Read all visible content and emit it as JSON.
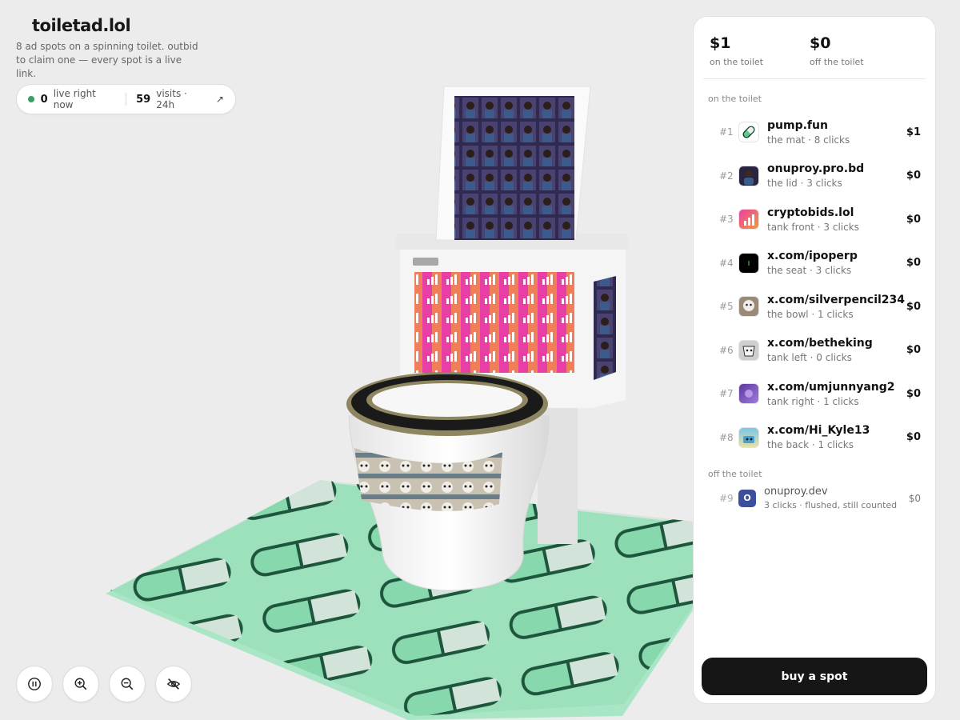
{
  "brand": {
    "title": "toiletad.lol",
    "tagline": "8 ad spots on a spinning toilet. outbid to claim one — every spot is a live link."
  },
  "stats": {
    "live_count": "0",
    "live_label": "live right now",
    "visits_count": "59",
    "visits_label": "visits · 24h",
    "arrow_icon": "↗"
  },
  "controls": {
    "pause_icon": "pause-icon",
    "zoom_in_icon": "zoom-in-icon",
    "zoom_out_icon": "zoom-out-icon",
    "hide_icon": "eye-off-icon"
  },
  "panel": {
    "on_total": "$1",
    "on_label": "on the toilet",
    "off_total": "$0",
    "off_label": "off the toilet",
    "on_section": "on the toilet",
    "off_section": "off the toilet",
    "spots": [
      {
        "rank": "#1",
        "name": "pump.fun",
        "sub": "the mat · 8 clicks",
        "price": "$1",
        "thumb_color": "#ffffff"
      },
      {
        "rank": "#2",
        "name": "onuproy.pro.bd",
        "sub": "the lid · 3 clicks",
        "price": "$0",
        "thumb_color": "#2a2440"
      },
      {
        "rank": "#3",
        "name": "cryptobids.lol",
        "sub": "tank front · 3 clicks",
        "price": "$0",
        "thumb_color": "#e83fa6"
      },
      {
        "rank": "#4",
        "name": "x.com/ipoperp",
        "sub": "the seat · 3 clicks",
        "price": "$0",
        "thumb_color": "#000000"
      },
      {
        "rank": "#5",
        "name": "x.com/silverpencil234",
        "sub": "the bowl · 1 clicks",
        "price": "$0",
        "thumb_color": "#9a8a78"
      },
      {
        "rank": "#6",
        "name": "x.com/betheking",
        "sub": "tank left · 0 clicks",
        "price": "$0",
        "thumb_color": "#cfcfcf"
      },
      {
        "rank": "#7",
        "name": "x.com/umjunnyang2",
        "sub": "tank right · 1 clicks",
        "price": "$0",
        "thumb_color": "#7a4bc4"
      },
      {
        "rank": "#8",
        "name": "x.com/Hi_Kyle13",
        "sub": "the back · 1 clicks",
        "price": "$0",
        "thumb_color": "#7ac6e8"
      }
    ],
    "off_spots": [
      {
        "rank": "#9",
        "initial": "O",
        "name": "onuproy.dev",
        "sub": "3 clicks · flushed, still counted",
        "price": "$0"
      }
    ],
    "buy_label": "buy a spot"
  },
  "colors": {
    "accent": "#161616",
    "live": "#3aa062",
    "mat": "#6cc594",
    "pill_green": "#7ed3a2"
  }
}
